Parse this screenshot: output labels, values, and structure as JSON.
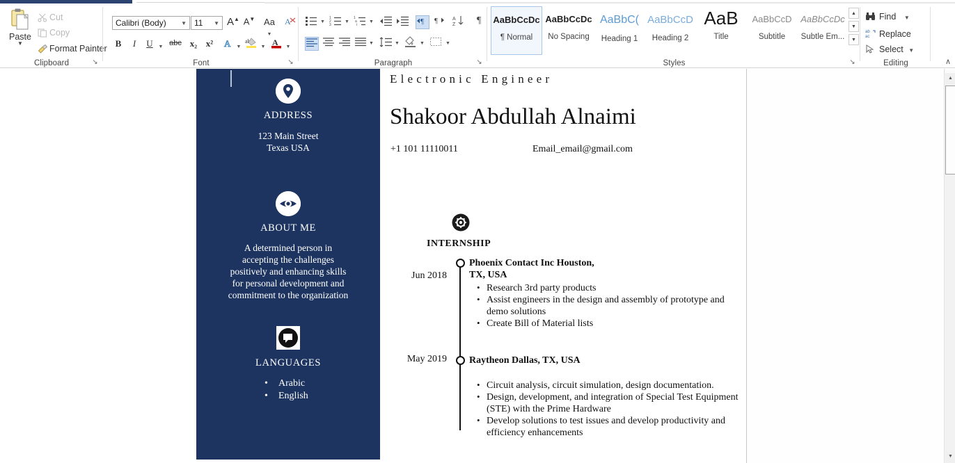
{
  "app": {
    "name": "Microsoft Word"
  },
  "ribbon": {
    "clipboard": {
      "group_label": "Clipboard",
      "paste_label": "Paste",
      "paste_caret": "▼",
      "items": [
        {
          "icon": "scissors-icon",
          "label": "Cut"
        },
        {
          "icon": "copy-icon",
          "label": "Copy"
        },
        {
          "icon": "format-painter-icon",
          "label": "Format Painter"
        }
      ],
      "dialog_launcher": "↘"
    },
    "font": {
      "group_label": "Font",
      "font_name": "Calibri (Body)",
      "font_size": "11",
      "grow_font": "A",
      "shrink_font": "A",
      "change_case": "Aa",
      "clear_formatting": "clear-formatting-icon",
      "bold": "B",
      "italic": "I",
      "underline": "U",
      "strikethrough": "abc",
      "subscript": "x₂",
      "superscript": "x²",
      "text_effects": "A",
      "highlight": "ab",
      "font_color": "A",
      "dialog_launcher": "↘"
    },
    "paragraph": {
      "group_label": "Paragraph",
      "dialog_launcher": "↘",
      "bullets": "bullets-icon",
      "numbering": "numbering-icon",
      "multilevel": "multilevel-list-icon",
      "decrease_indent": "decrease-indent-icon",
      "increase_indent": "increase-indent-icon",
      "ltr": "left-to-right-icon",
      "rtl": "right-to-left-icon",
      "sort": "sort-icon",
      "show_marks": "¶",
      "align_left": "align-left-icon",
      "align_center": "align-center-icon",
      "align_right": "align-right-icon",
      "justify": "justify-icon",
      "line_spacing": "line-spacing-icon",
      "shading": "shading-icon",
      "borders": "borders-icon"
    },
    "styles": {
      "group_label": "Styles",
      "dialog_launcher": "↘",
      "items": [
        {
          "preview": "AaBbCcDc",
          "name": "¶ Normal",
          "active": true
        },
        {
          "preview": "AaBbCcDc",
          "name": "No Spacing",
          "active": false
        },
        {
          "preview": "AaBbC(",
          "name": "Heading 1",
          "active": false
        },
        {
          "preview": "AaBbCcD",
          "name": "Heading 2",
          "active": false
        },
        {
          "preview": "AaB",
          "name": "Title",
          "active": false
        },
        {
          "preview": "AaBbCcD",
          "name": "Subtitle",
          "active": false
        },
        {
          "preview": "AaBbCcDc",
          "name": "Subtle Em...",
          "active": false
        }
      ],
      "scroll_up": "▲",
      "scroll_down": "▼",
      "more": "▬"
    },
    "editing": {
      "group_label": "Editing",
      "items": [
        {
          "icon": "binoculars-icon",
          "label": "Find",
          "caret": "▼"
        },
        {
          "icon": "replace-icon",
          "label": "Replace",
          "caret": ""
        },
        {
          "icon": "select-arrow-icon",
          "label": "Select",
          "caret": "▼"
        }
      ]
    },
    "collapse_ribbon": "∧"
  },
  "document": {
    "sidebar": {
      "accent_color": "#1d3461",
      "sections": [
        {
          "icon": "location-pin-icon",
          "heading": "ADDRESS",
          "lines": [
            "123 Main Street",
            "Texas USA"
          ]
        },
        {
          "icon": "eye-icon",
          "heading": "ABOUT ME",
          "lines": [
            "A determined person in",
            "accepting the challenges",
            "positively and enhancing skills",
            "for personal development and",
            "commitment to the organization"
          ]
        },
        {
          "icon": "speech-bubble-icon",
          "heading": "LANGUAGES",
          "list": [
            "Arabic",
            "English"
          ]
        }
      ]
    },
    "header": {
      "job_title": "Electronic Engineer",
      "name": "Shakoor Abdullah Alnaimi",
      "phone": "+1 101 11110011",
      "email": "Email_email@gmail.com"
    },
    "experience": {
      "icon": "gear-icon",
      "section_title": "INTERNSHIP",
      "entries": [
        {
          "date": "Jun 2018",
          "employer_line1": "Phoenix Contact Inc Houston,",
          "employer_line2": "TX, USA",
          "duties": [
            "Research 3rd party products",
            "Assist engineers in the design and assembly of prototype and demo solutions",
            "Create Bill of Material lists"
          ]
        },
        {
          "date": "May 2019",
          "employer_line1": "Raytheon Dallas, TX, USA",
          "employer_line2": "",
          "duties": [
            "Circuit analysis, circuit simulation, design documentation.",
            "Design, development, and integration of Special Test Equipment (STE) with the Prime Hardware",
            "Develop solutions to test issues and develop productivity and efficiency enhancements"
          ]
        }
      ]
    }
  },
  "scrollbar": {
    "split": "split-handle",
    "up_arrow": "▲",
    "down_arrow": "▼"
  }
}
